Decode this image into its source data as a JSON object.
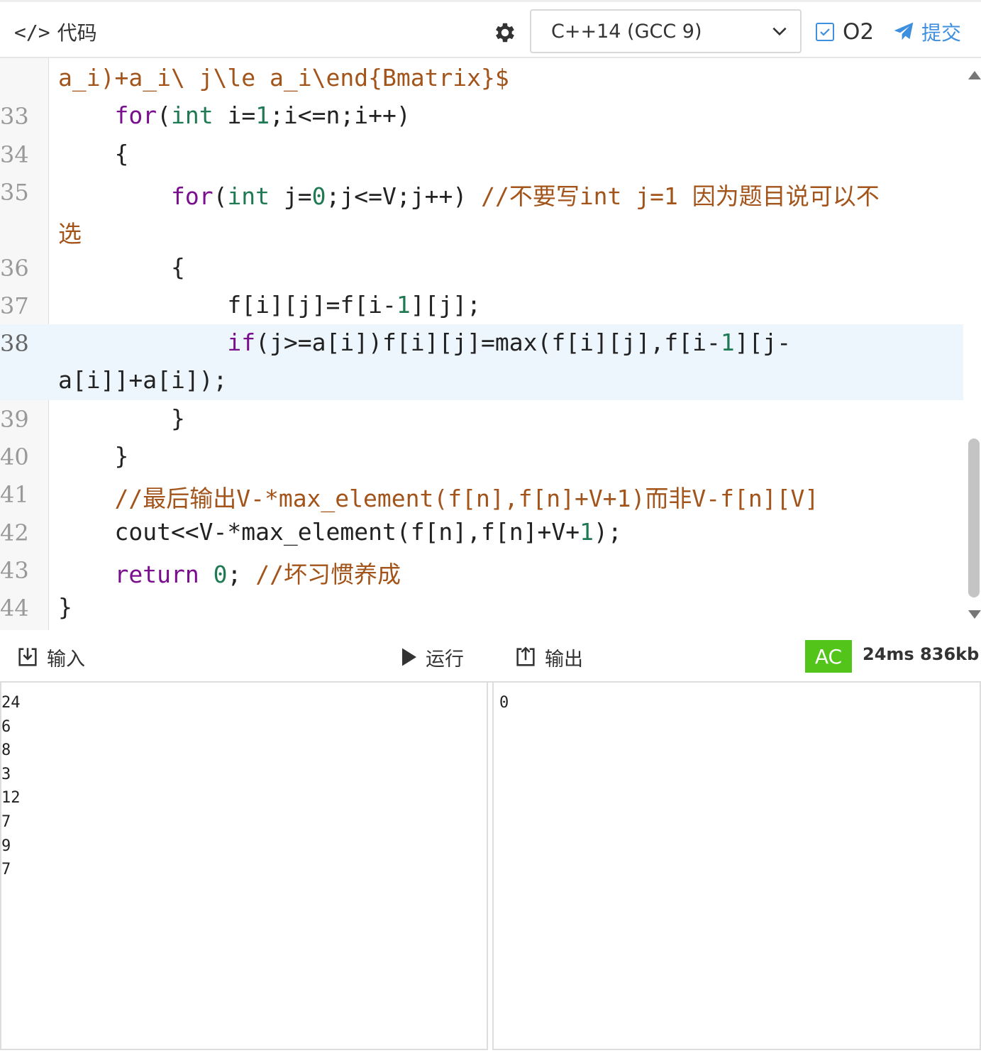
{
  "toolbar": {
    "code_tab_glyph": "</>",
    "code_tab_label": "代码",
    "language": "C++14 (GCC 9)",
    "o2_label": "O2",
    "submit_label": "提交",
    "accent_color": "#3e8fdd"
  },
  "editor": {
    "lines": [
      {
        "num": "",
        "tokens": [
          [
            "c",
            "a_i)+a_i\\ j\\le a_i\\end{Bmatrix}$"
          ]
        ]
      },
      {
        "num": "33",
        "tokens": [
          [
            "p",
            "    "
          ],
          [
            "k",
            "for"
          ],
          [
            "p",
            "("
          ],
          [
            "t",
            "int"
          ],
          [
            "p",
            " i="
          ],
          [
            "n",
            "1"
          ],
          [
            "p",
            ";i<=n;i++)"
          ]
        ]
      },
      {
        "num": "34",
        "tokens": [
          [
            "p",
            "    {"
          ]
        ]
      },
      {
        "num": "35",
        "tokens": [
          [
            "p",
            "        "
          ],
          [
            "k",
            "for"
          ],
          [
            "p",
            "("
          ],
          [
            "t",
            "int"
          ],
          [
            "p",
            " j="
          ],
          [
            "n",
            "0"
          ],
          [
            "p",
            ";j<=V;j++) "
          ],
          [
            "c",
            "//不要写int j=1 因为题目说可以不"
          ]
        ]
      },
      {
        "num": "",
        "tokens": [
          [
            "c",
            "选"
          ]
        ]
      },
      {
        "num": "36",
        "tokens": [
          [
            "p",
            "        {"
          ]
        ]
      },
      {
        "num": "37",
        "tokens": [
          [
            "p",
            "            f[i][j]=f[i-"
          ],
          [
            "n",
            "1"
          ],
          [
            "p",
            "][j];"
          ]
        ]
      },
      {
        "num": "38",
        "tokens": [
          [
            "p",
            "            "
          ],
          [
            "k",
            "if"
          ],
          [
            "p",
            "(j>=a[i])f[i][j]=max(f[i][j],f[i-"
          ],
          [
            "n",
            "1"
          ],
          [
            "p",
            "][j-"
          ]
        ]
      },
      {
        "num": "",
        "tokens": [
          [
            "p",
            "a[i]]+a[i]);"
          ]
        ]
      },
      {
        "num": "39",
        "tokens": [
          [
            "p",
            "        }"
          ]
        ]
      },
      {
        "num": "40",
        "tokens": [
          [
            "p",
            "    }"
          ]
        ]
      },
      {
        "num": "41",
        "tokens": [
          [
            "p",
            "    "
          ],
          [
            "c",
            "//最后输出V-*max_element(f[n],f[n]+V+1)而非V-f[n][V]"
          ]
        ]
      },
      {
        "num": "42",
        "tokens": [
          [
            "p",
            "    cout<<V-*max_element(f[n],f[n]+V+"
          ],
          [
            "n",
            "1"
          ],
          [
            "p",
            ");"
          ]
        ]
      },
      {
        "num": "43",
        "tokens": [
          [
            "p",
            "    "
          ],
          [
            "k",
            "return"
          ],
          [
            "p",
            " "
          ],
          [
            "n",
            "0"
          ],
          [
            "p",
            "; "
          ],
          [
            "c",
            "//坏习惯养成"
          ]
        ]
      },
      {
        "num": "44",
        "tokens": [
          [
            "p",
            "}"
          ]
        ]
      }
    ],
    "active_line": "38"
  },
  "io": {
    "input_label": "输入",
    "run_label": "运行",
    "output_label": "输出",
    "status": "AC",
    "status_color": "#52c41a",
    "stats": "24ms 836kb",
    "input_text": "24\n6\n8\n3\n12\n7\n9\n7",
    "output_text": "0"
  }
}
